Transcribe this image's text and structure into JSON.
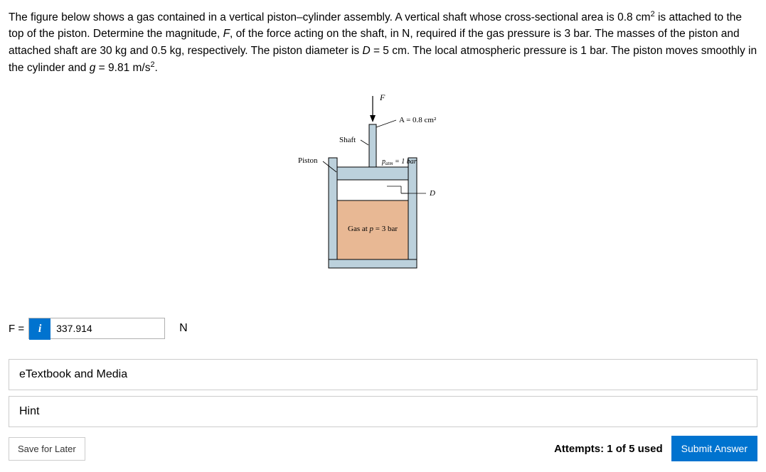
{
  "problem": {
    "statement": "The figure below shows a gas contained in a vertical piston-cylinder assembly. A vertical shaft whose cross-sectional area is 0.8 cm² is attached to the top of the piston. Determine the magnitude, F, of the force acting on the shaft, in N, required if the gas pressure is 3 bar. The masses of the piston and attached shaft are 30 kg and 0.5 kg, respectively. The piston diameter is D = 5 cm. The local atmospheric pressure is 1 bar. The piston moves smoothly in the cylinder and g = 9.81 m/s²."
  },
  "diagram": {
    "force_label": "F",
    "area_label": "A = 0.8 cm²",
    "shaft_label": "Shaft",
    "piston_label": "Piston",
    "patm_label": "pₐₜₘ = 1 bar",
    "d_label": "D",
    "gas_label": "Gas at p = 3 bar"
  },
  "answer": {
    "prefix": "F =",
    "value": "337.914",
    "unit": "N",
    "info_icon": "i"
  },
  "expandables": {
    "etextbook": "eTextbook and Media",
    "hint": "Hint"
  },
  "footer": {
    "save": "Save for Later",
    "attempts": "Attempts: 1 of 5 used",
    "submit": "Submit Answer"
  }
}
